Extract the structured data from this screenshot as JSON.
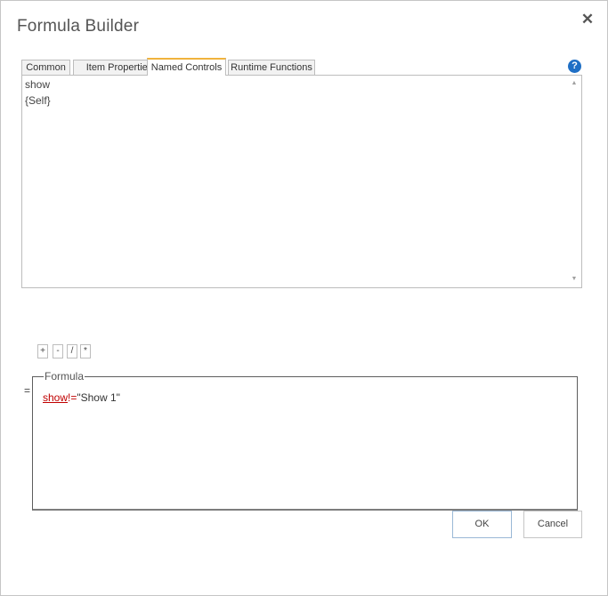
{
  "dialog": {
    "title": "Formula Builder",
    "close_glyph": "✕",
    "help_glyph": "?"
  },
  "tabs": [
    {
      "label": "Common"
    },
    {
      "label": "Item Properties"
    },
    {
      "label": "Named Controls",
      "active": true
    },
    {
      "label": "Runtime Functions"
    }
  ],
  "named_controls": {
    "items": [
      "show",
      "{Self}"
    ]
  },
  "operators": [
    "+",
    "-",
    "/",
    "*"
  ],
  "formula": {
    "prefix": "=",
    "legend": "Formula",
    "tokens": {
      "ref": "show",
      "op": "!=",
      "value": "\"Show 1\""
    }
  },
  "buttons": {
    "ok": "OK",
    "cancel": "Cancel"
  },
  "icons": {
    "close": "close-icon",
    "help": "help-icon",
    "scroll_up": "chevron-up-icon",
    "scroll_down": "chevron-down-icon"
  },
  "colors": {
    "active_tab_accent": "#f0b33d",
    "help_icon": "#1f6fc5",
    "reference_text": "#c00000"
  }
}
